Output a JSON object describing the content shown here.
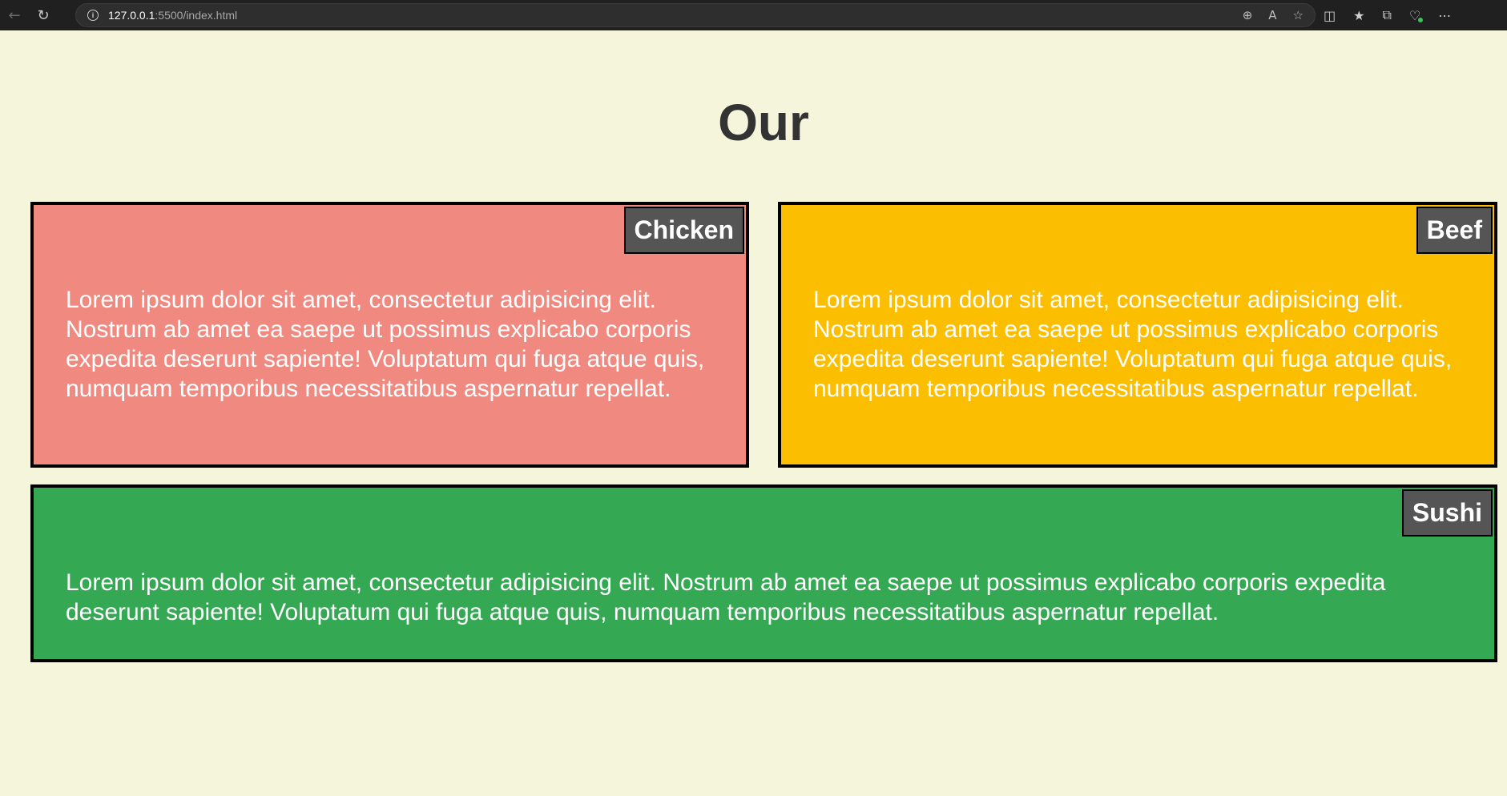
{
  "browser": {
    "back_icon": "back-arrow-icon",
    "reload_icon": "reload-icon",
    "url_host": "127.0.0.1",
    "url_path": ":5500/index.html"
  },
  "page": {
    "title": "Our",
    "cards": [
      {
        "badge": "Chicken",
        "text": "Lorem ipsum dolor sit amet, consectetur adipisicing elit. Nostrum ab amet ea saepe ut possimus explicabo corporis expedita deserunt sapiente! Voluptatum qui fuga atque quis, numquam temporibus necessitatibus aspernatur repellat.",
        "color": "#f08a80"
      },
      {
        "badge": "Beef",
        "text": "Lorem ipsum dolor sit amet, consectetur adipisicing elit. Nostrum ab amet ea saepe ut possimus explicabo corporis expedita deserunt sapiente! Voluptatum qui fuga atque quis, numquam temporibus necessitatibus aspernatur repellat.",
        "color": "#fbbe00"
      },
      {
        "badge": "Sushi",
        "text": "Lorem ipsum dolor sit amet, consectetur adipisicing elit. Nostrum ab amet ea saepe ut possimus explicabo corporis expedita deserunt sapiente! Voluptatum qui fuga atque quis, numquam temporibus necessitatibus aspernatur repellat.",
        "color": "#35a854"
      }
    ]
  }
}
